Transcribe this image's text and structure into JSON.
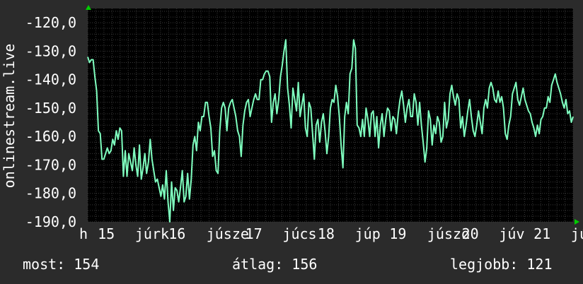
{
  "colors": {
    "background": "#2b2b2b",
    "plot_background": "#000000",
    "grid": "#3a3a3a",
    "line": "#7fffbf",
    "axis_arrow": "#00cc00",
    "text": "#ffffff"
  },
  "stats": {
    "now": "most: 154",
    "avg": "átlag: 156",
    "best": "legjobb: 121"
  },
  "chart_data": {
    "type": "line",
    "ylabel": "onlinestream.live",
    "ylim": [
      -190,
      -115
    ],
    "yticks": [
      -190,
      -180,
      -170,
      -160,
      -150,
      -140,
      -130,
      -120
    ],
    "ytick_labels": [
      "-190,0",
      "-180,0",
      "-170,0",
      "-160,0",
      "-150,0",
      "-140,0",
      "-130,0",
      "-120,0"
    ],
    "xlim": [
      0,
      1
    ],
    "xtick_labels": [
      {
        "label": "h",
        "x": 0.0
      },
      {
        "label": "15",
        "x": 0.038
      },
      {
        "label": "júrk",
        "x": 0.115
      },
      {
        "label": "16",
        "x": 0.184
      },
      {
        "label": "júsze",
        "x": 0.262
      },
      {
        "label": "17",
        "x": 0.342
      },
      {
        "label": "júcs",
        "x": 0.419
      },
      {
        "label": "18",
        "x": 0.491
      },
      {
        "label": "júp",
        "x": 0.568
      },
      {
        "label": "19",
        "x": 0.639
      },
      {
        "label": "júszo",
        "x": 0.717
      },
      {
        "label": "20",
        "x": 0.788
      },
      {
        "label": "júv",
        "x": 0.865
      },
      {
        "label": "21",
        "x": 0.936
      },
      {
        "label": "jún",
        "x": 1.013
      }
    ],
    "grid": true,
    "series": [
      {
        "values": [
          -132,
          -134,
          -133,
          -133,
          -139,
          -144,
          -158,
          -159,
          -168,
          -168,
          -166,
          -164,
          -166,
          -165,
          -161,
          -163,
          -158,
          -161,
          -157,
          -158,
          -174,
          -165,
          -174,
          -166,
          -169,
          -172,
          -164,
          -170,
          -174,
          -163,
          -175,
          -171,
          -166,
          -173,
          -169,
          -161,
          -168,
          -172,
          -176,
          -175,
          -178,
          -181,
          -177,
          -182,
          -172,
          -183,
          -190,
          -176,
          -186,
          -178,
          -179,
          -183,
          -178,
          -172,
          -183,
          -181,
          -173,
          -182,
          -175,
          -163,
          -160,
          -165,
          -155,
          -158,
          -153,
          -153,
          -148,
          -148,
          -153,
          -157,
          -167,
          -165,
          -172,
          -173,
          -158,
          -150,
          -148,
          -150,
          -158,
          -150,
          -148,
          -147,
          -150,
          -153,
          -158,
          -160,
          -167,
          -156,
          -151,
          -148,
          -147,
          -153,
          -150,
          -147,
          -145,
          -147,
          -147,
          -140,
          -140,
          -138,
          -137,
          -137,
          -139,
          -155,
          -148,
          -145,
          -152,
          -147,
          -139,
          -135,
          -130,
          -126,
          -143,
          -149,
          -157,
          -143,
          -147,
          -151,
          -141,
          -153,
          -149,
          -145,
          -157,
          -160,
          -148,
          -150,
          -159,
          -168,
          -156,
          -154,
          -162,
          -155,
          -152,
          -158,
          -166,
          -160,
          -150,
          -147,
          -148,
          -142,
          -146,
          -153,
          -163,
          -171,
          -153,
          -148,
          -152,
          -138,
          -136,
          -126,
          -129,
          -156,
          -157,
          -160,
          -154,
          -160,
          -150,
          -154,
          -160,
          -152,
          -151,
          -160,
          -153,
          -164,
          -156,
          -152,
          -160,
          -154,
          -150,
          -151,
          -158,
          -153,
          -154,
          -159,
          -152,
          -147,
          -144,
          -149,
          -155,
          -150,
          -147,
          -153,
          -153,
          -145,
          -148,
          -156,
          -148,
          -156,
          -162,
          -169,
          -164,
          -151,
          -154,
          -163,
          -156,
          -159,
          -153,
          -155,
          -162,
          -160,
          -148,
          -157,
          -154,
          -145,
          -142,
          -146,
          -149,
          -145,
          -147,
          -157,
          -153,
          -160,
          -156,
          -151,
          -147,
          -153,
          -158,
          -160,
          -156,
          -151,
          -155,
          -159,
          -150,
          -147,
          -150,
          -143,
          -141,
          -143,
          -147,
          -148,
          -144,
          -148,
          -146,
          -150,
          -159,
          -161,
          -156,
          -153,
          -145,
          -143,
          -141,
          -147,
          -149,
          -146,
          -143,
          -147,
          -149,
          -151,
          -152,
          -155,
          -157,
          -160,
          -156,
          -159,
          -154,
          -153,
          -150,
          -150,
          -146,
          -148,
          -142,
          -140,
          -138,
          -141,
          -143,
          -145,
          -148,
          -150,
          -147,
          -152,
          -151,
          -155,
          -153
        ]
      }
    ]
  }
}
